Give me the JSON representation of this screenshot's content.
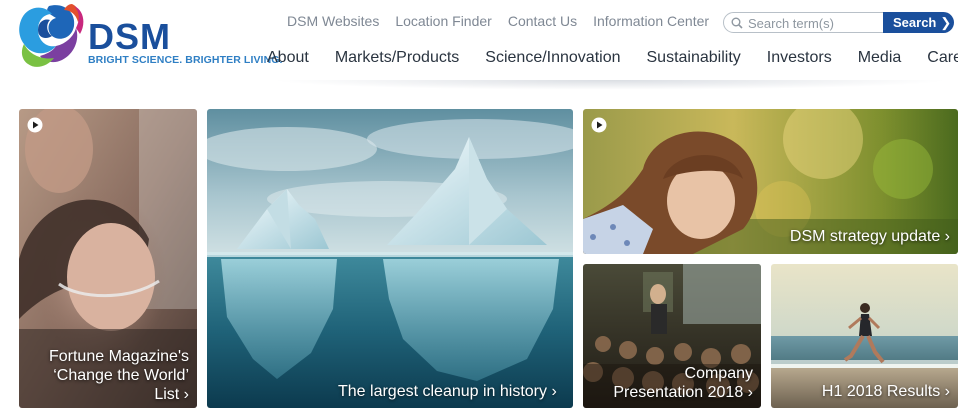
{
  "brand": {
    "name": "DSM",
    "tagline": "BRIGHT SCIENCE. BRIGHTER LIVING."
  },
  "utility_nav": [
    "DSM Websites",
    "Location Finder",
    "Contact Us",
    "Information Center"
  ],
  "search": {
    "placeholder": "Search term(s)",
    "button_label": "Search"
  },
  "main_nav": [
    "About",
    "Markets/Products",
    "Science/Innovation",
    "Sustainability",
    "Investors",
    "Media",
    "Careers"
  ],
  "tiles": {
    "fortune": {
      "line1": "Fortune Magazine's",
      "line2": "‘Change the World’",
      "line3": "List",
      "chevron": "›",
      "has_video": true
    },
    "cleanup": {
      "caption": "The largest cleanup in history",
      "chevron": "›"
    },
    "strategy": {
      "caption": "DSM strategy update",
      "chevron": "›",
      "has_video": true
    },
    "company": {
      "line1": "Company",
      "line2": "Presentation 2018",
      "chevron": "›"
    },
    "h1": {
      "caption": "H1 2018 Results",
      "chevron": "›"
    }
  },
  "colors": {
    "brand_blue": "#1a4f9c",
    "tagline_blue": "#2f7fc4",
    "nav_text": "#2a3440",
    "util_text": "#7f8894"
  }
}
